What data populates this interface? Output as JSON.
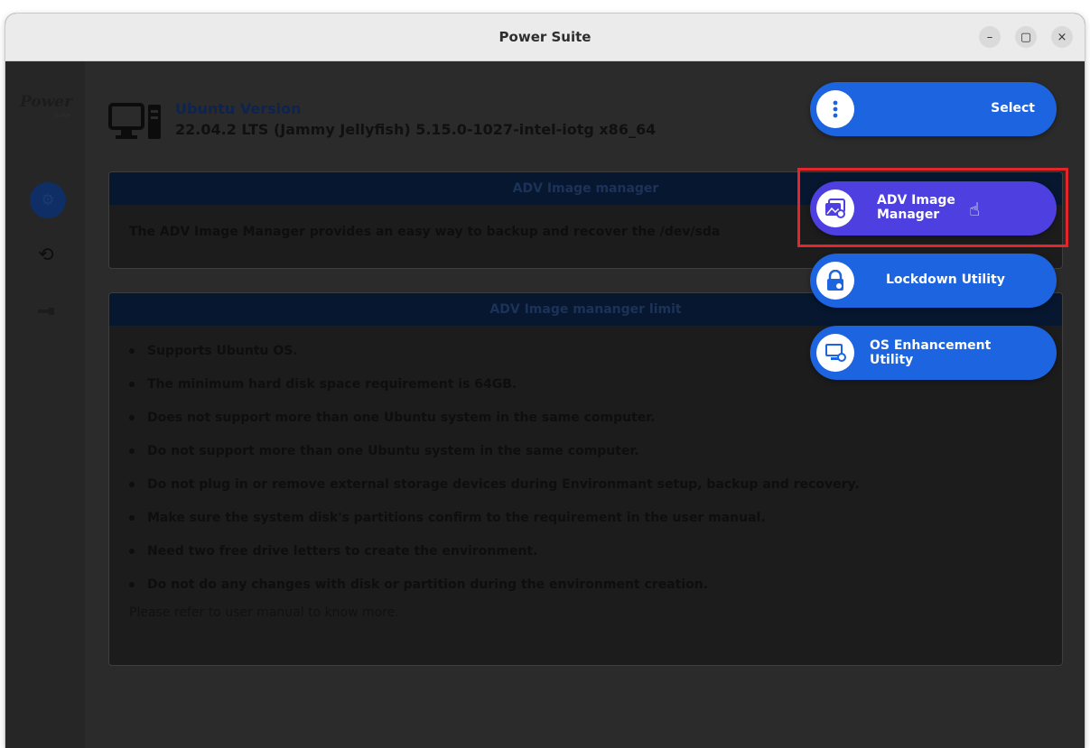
{
  "window": {
    "title": "Power Suite",
    "minimize_glyph": "–",
    "maximize_glyph": "▢",
    "close_glyph": "×"
  },
  "sidebar": {
    "logo": "Power",
    "logo_sub": "Suite",
    "items": [
      {
        "icon": "gear-icon"
      },
      {
        "icon": "restore-icon"
      },
      {
        "icon": "usb-icon"
      }
    ]
  },
  "header": {
    "version_label": "Ubuntu Version",
    "version_value": "22.04.2 LTS (Jammy Jellyfish) 5.15.0-1027-intel-iotg x86_64"
  },
  "panel_manager": {
    "title": "ADV Image manager",
    "text": "The ADV Image Manager provides an easy way to backup and recover the /dev/sda"
  },
  "panel_limit": {
    "title": "ADV Image mananger limit",
    "items": [
      "Supports Ubuntu OS.",
      "The minimum hard disk space requirement is 64GB.",
      "Does not support more than one Ubuntu system in the same computer.",
      "Do not support more than one Ubuntu system in the same computer.",
      "Do not plug in or remove external storage devices during Environmant setup, backup and recovery.",
      "Make sure the system disk's partitions confirm to the requirement in the user manual.",
      "Need two free drive letters to create the environment.",
      "Do not do any changes with disk or partition during the environment creation."
    ],
    "footnote": "Please refer to user manual to know more."
  },
  "select_menu": {
    "trigger_label": "Select",
    "items": [
      {
        "label_line1": "ADV Image",
        "label_line2": "Manager",
        "icon": "image-settings-icon",
        "color": "#4d3fe0",
        "highlighted": true
      },
      {
        "label_line1": "Lockdown Utility",
        "label_line2": "",
        "icon": "lock-settings-icon",
        "color": "#1c64e0"
      },
      {
        "label_line1": "OS Enhancement",
        "label_line2": "Utility",
        "icon": "monitor-settings-icon",
        "color": "#1c64e0"
      }
    ]
  },
  "colors": {
    "accent": "#1c64e0",
    "selected": "#4d3fe0",
    "highlight": "#e3262c",
    "overlay": "#2b2b2b"
  }
}
